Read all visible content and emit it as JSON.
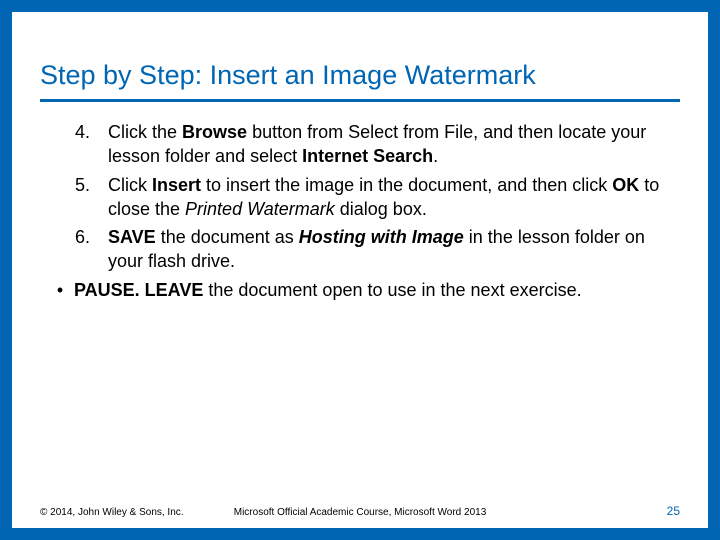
{
  "title": "Step by Step: Insert an Image Watermark",
  "steps": {
    "s4": {
      "num": "4.",
      "p1": "Click the ",
      "b1": "Browse",
      "p2": " button from Select from File, and then locate your lesson folder and select ",
      "b2": "Internet Search",
      "p3": "."
    },
    "s5": {
      "num": "5.",
      "p1": "Click ",
      "b1": "Insert",
      "p2": " to insert the image in the document, and then click ",
      "b2": "OK",
      "p3": " to close the ",
      "i1": "Printed Watermark",
      "p4": " dialog box."
    },
    "s6": {
      "num": "6.",
      "b1": " SAVE",
      "p1": " the document as ",
      "bi1": "Hosting with Image",
      "p2": " in the lesson folder on your flash drive."
    }
  },
  "bullet": {
    "mark": "•",
    "b1": "PAUSE. LEAVE",
    "p1": " the document open to use in the next exercise."
  },
  "footer": {
    "left": "© 2014, John Wiley & Sons, Inc.",
    "center": "Microsoft Official Academic Course, Microsoft Word 2013",
    "right": "25"
  }
}
